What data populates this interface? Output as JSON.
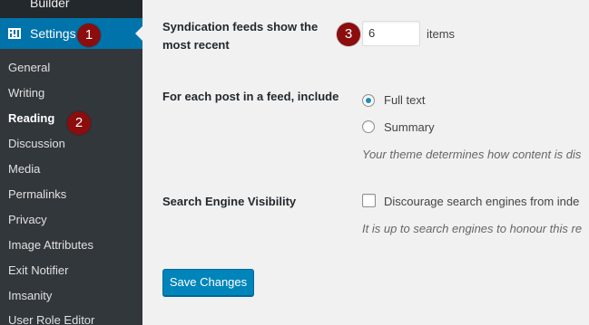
{
  "sidebar": {
    "partial_item_label": "Builder",
    "settings_label": "Settings",
    "submenu": [
      {
        "label": "General"
      },
      {
        "label": "Writing"
      },
      {
        "label": "Reading"
      },
      {
        "label": "Discussion"
      },
      {
        "label": "Media"
      },
      {
        "label": "Permalinks"
      },
      {
        "label": "Privacy"
      },
      {
        "label": "Image Attributes"
      },
      {
        "label": "Exit Notifier"
      },
      {
        "label": "Imsanity"
      },
      {
        "label": "User Role Editor"
      }
    ],
    "current_item": "Reading"
  },
  "badges": {
    "one": "1",
    "two": "2",
    "three": "3",
    "color": "#8b0d0d"
  },
  "main": {
    "syndication": {
      "label_line1": "Syndication feeds show the",
      "label_line2": "most recent",
      "value": "6",
      "unit": "items"
    },
    "feed_content": {
      "label": "For each post in a feed, include",
      "options": [
        {
          "label": "Full text",
          "checked": true
        },
        {
          "label": "Summary",
          "checked": false
        }
      ],
      "description": "Your theme determines how content is dis"
    },
    "search_visibility": {
      "label": "Search Engine Visibility",
      "checkbox_label": "Discourage search engines from inde",
      "checked": false,
      "description": "It is up to search engines to honour this re"
    },
    "save_label": "Save Changes"
  },
  "colors": {
    "sidebar_bg": "#23282d",
    "submenu_bg": "#32373c",
    "accent": "#0073aa",
    "button": "#0085ba",
    "page_bg": "#f1f1f1"
  },
  "icons": {
    "settings": "settings-sliders-icon"
  }
}
